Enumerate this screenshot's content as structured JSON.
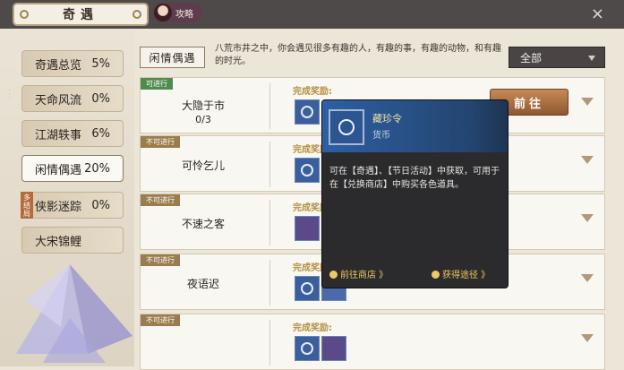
{
  "header": {
    "title": "奇遇",
    "guide_label": "攻略",
    "close_icon": "×"
  },
  "sidebar": {
    "items": [
      {
        "label": "奇遇总览",
        "pct": "5%"
      },
      {
        "label": "天命风流",
        "pct": "0%"
      },
      {
        "label": "江湖轶事",
        "pct": "6%"
      },
      {
        "label": "闲情偶遇",
        "pct": "20%"
      },
      {
        "label": "侠影迷踪",
        "pct": "0%"
      },
      {
        "label": "大宋锦鲤",
        "pct": ""
      }
    ],
    "badge": "多结局"
  },
  "section": {
    "title": "闲情偶遇",
    "description": "八荒市井之中，你会遇见很多有趣的人，有趣的事，有趣的动物，和有趣的时光。",
    "filter": "全部"
  },
  "tasks": [
    {
      "tag": "可进行",
      "name": "大隐于市",
      "progress": "0/3",
      "reward_label": "完成奖励:",
      "action": "前往"
    },
    {
      "tag": "不可进行",
      "name": "可怜乞儿",
      "reward_label": "完成奖励:"
    },
    {
      "tag": "不可进行",
      "name": "不速之客",
      "reward_label": "完成奖励:"
    },
    {
      "tag": "不可进行",
      "name": "夜语迟",
      "reward_label": "完成奖励:"
    },
    {
      "tag": "不可进行",
      "name": "",
      "reward_label": "完成奖励:"
    }
  ],
  "popup": {
    "name": "藏珍令",
    "type": "货币",
    "desc": "可在【奇遇】、【节日活动】中获取，可用于在【兑换商店】中购买各色道具。",
    "link_shop": "前往商店 》",
    "link_source": "获得途径 》"
  },
  "colors": {
    "accent": "#2d5fa3",
    "gold": "#f0c864"
  }
}
